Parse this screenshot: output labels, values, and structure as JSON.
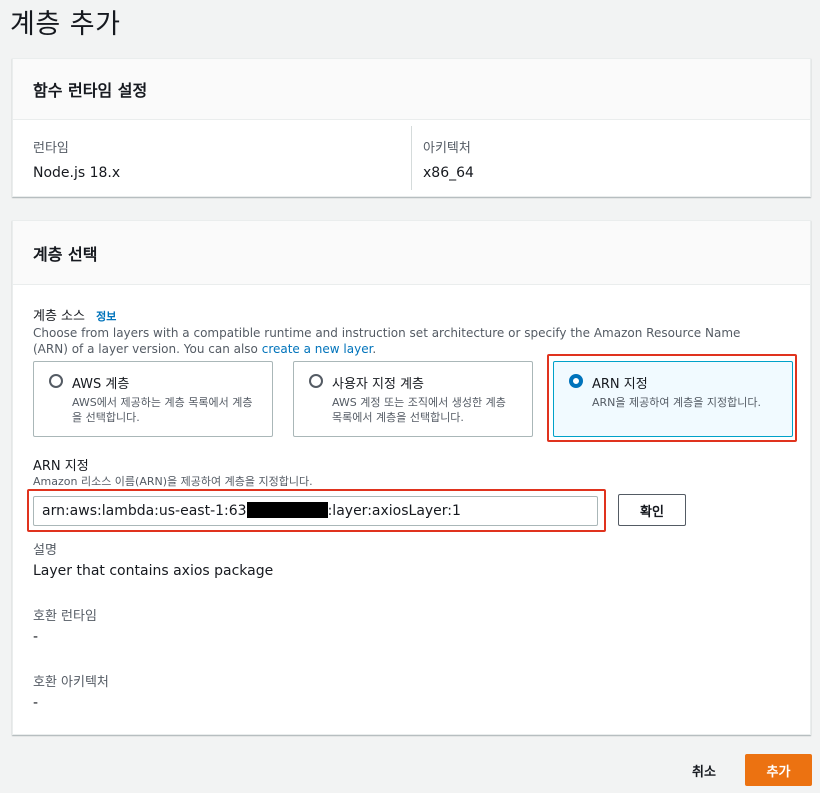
{
  "page": {
    "title": "계층 추가"
  },
  "runtime_panel": {
    "heading": "함수 런타임 설정",
    "runtime_label": "런타임",
    "runtime_value": "Node.js 18.x",
    "architecture_label": "아키텍처",
    "architecture_value": "x86_64"
  },
  "layer_panel": {
    "heading": "계층 선택",
    "source_label": "계층 소스",
    "info_link": "정보",
    "source_desc": "Choose from layers with a compatible runtime and instruction set architecture or specify the Amazon Resource Name (ARN) of a layer version. You can also ",
    "source_desc_link": "create a new layer",
    "source_desc_end": ".",
    "options": [
      {
        "label": "AWS 계층",
        "desc": "AWS에서 제공하는 계층 목록에서 계층을 선택합니다.",
        "selected": false
      },
      {
        "label": "사용자 지정 계층",
        "desc": "AWS 계정 또는 조직에서 생성한 계층 목록에서 계층을 선택합니다.",
        "selected": false
      },
      {
        "label": "ARN 지정",
        "desc": "ARN을 제공하여 계층을 지정합니다.",
        "selected": true
      }
    ],
    "arn_label": "ARN 지정",
    "arn_desc": "Amazon 리소스 이름(ARN)을 제공하여 계층을 지정합니다.",
    "arn_value_prefix": "arn:aws:lambda:us-east-1:63",
    "arn_value_suffix": ":layer:axiosLayer:1",
    "confirm_button": "확인",
    "description_label": "설명",
    "description_value": "Layer that contains axios package",
    "compatible_runtimes_label": "호환 런타임",
    "compatible_runtimes_value": "-",
    "compatible_arch_label": "호환 아키텍처",
    "compatible_arch_value": "-"
  },
  "footer": {
    "cancel": "취소",
    "add": "추가"
  },
  "colors": {
    "accent": "#ec7211",
    "link": "#0073bb",
    "highlight": "#e0331e",
    "selected_tile_bg": "#f1faff"
  }
}
